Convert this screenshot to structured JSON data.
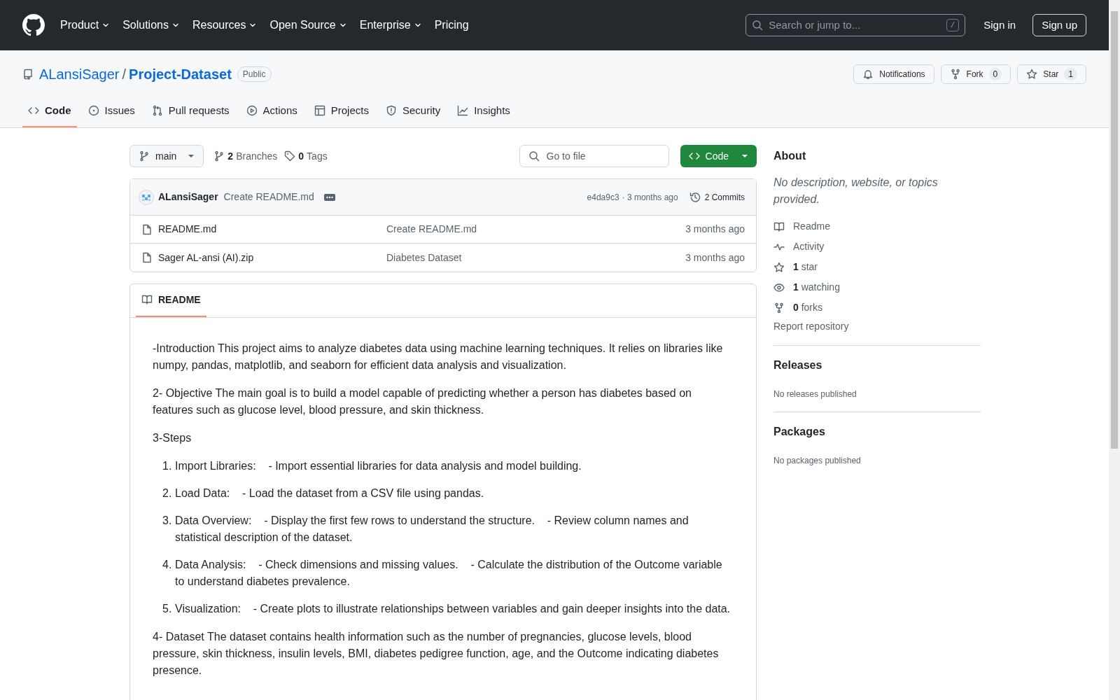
{
  "header": {
    "nav": [
      {
        "label": "Product",
        "dropdown": true
      },
      {
        "label": "Solutions",
        "dropdown": true
      },
      {
        "label": "Resources",
        "dropdown": true
      },
      {
        "label": "Open Source",
        "dropdown": true
      },
      {
        "label": "Enterprise",
        "dropdown": true
      },
      {
        "label": "Pricing",
        "dropdown": false
      }
    ],
    "search": {
      "placeholder": "Search or jump to...",
      "shortcut": "/"
    },
    "sign_in": "Sign in",
    "sign_up": "Sign up"
  },
  "repo": {
    "owner": "ALansiSager",
    "separator": "/",
    "name": "Project-Dataset",
    "visibility": "Public",
    "actions": [
      {
        "kind": "notifications",
        "label": "Notifications"
      },
      {
        "kind": "fork",
        "label": "Fork",
        "count": "0"
      },
      {
        "kind": "star",
        "label": "Star",
        "count": "1"
      }
    ]
  },
  "tabs": [
    {
      "kind": "code",
      "label": "Code",
      "selected": true
    },
    {
      "kind": "issues",
      "label": "Issues",
      "selected": false
    },
    {
      "kind": "pulls",
      "label": "Pull requests",
      "selected": false
    },
    {
      "kind": "actions",
      "label": "Actions",
      "selected": false
    },
    {
      "kind": "projects",
      "label": "Projects",
      "selected": false
    },
    {
      "kind": "security",
      "label": "Security",
      "selected": false
    },
    {
      "kind": "insights",
      "label": "Insights",
      "selected": false
    }
  ],
  "toolbar": {
    "branch": "main",
    "branches_count": "2",
    "branches_label": "Branches",
    "tags_count": "0",
    "tags_label": "Tags",
    "go_to_file": "Go to file",
    "code_button": "Code"
  },
  "latest_commit": {
    "author": "ALansiSager",
    "message": "Create README.md",
    "hash": "e4da9c3",
    "time": "· 3 months ago",
    "commits": "2 Commits"
  },
  "files": [
    {
      "name": "README.md",
      "message": "Create README.md",
      "time": "3 months ago"
    },
    {
      "name": "Sager AL-ansi (AI).zip",
      "message": "Diabetes Dataset",
      "time": "3 months ago"
    }
  ],
  "readme": {
    "tab": "README",
    "blocks": [
      {
        "kind": "paragraph",
        "text": "-Introduction This project aims to analyze diabetes data using machine learning techniques. It relies on libraries like numpy, pandas, matplotlib, and seaborn for efficient data analysis and visualization."
      },
      {
        "kind": "paragraph",
        "text": "2- Objective The main goal is to build a model capable of predicting whether a person has diabetes based on features such as glucose level, blood pressure, and skin thickness."
      },
      {
        "kind": "paragraph",
        "text": "3-Steps"
      },
      {
        "kind": "list",
        "items": [
          {
            "number": "1.",
            "text": "Import Libraries:    - Import essential libraries for data analysis and model building."
          },
          {
            "number": "2.",
            "text": "Load Data:    - Load the dataset from a CSV file using pandas."
          },
          {
            "number": "3.",
            "text": "Data Overview:    - Display the first few rows to understand the structure.    - Review column names and statistical description of the dataset."
          },
          {
            "number": "4.",
            "text": "Data Analysis:    - Check dimensions and missing values.    - Calculate the distribution of the Outcome variable to understand diabetes prevalence."
          },
          {
            "number": "5.",
            "text": "Visualization:    - Create plots to illustrate relationships between variables and gain deeper insights into the data."
          }
        ]
      },
      {
        "kind": "paragraph",
        "text": "4- Dataset The dataset contains health information such as the number of pregnancies, glucose levels, blood pressure, skin thickness, insulin levels, BMI, diabetes pedigree function, age, and the Outcome indicating diabetes presence."
      }
    ]
  },
  "about": {
    "title": "About",
    "description": "No description, website, or topics provided.",
    "links": [
      {
        "kind": "readme",
        "label": "Readme"
      },
      {
        "kind": "activity",
        "label": "Activity"
      },
      {
        "kind": "star",
        "count": "1",
        "label": "star"
      },
      {
        "kind": "watch",
        "count": "1",
        "label": "watching"
      },
      {
        "kind": "fork",
        "count": "0",
        "label": "forks"
      }
    ],
    "report": "Report repository"
  },
  "releases": {
    "title": "Releases",
    "empty": "No releases published"
  },
  "packages": {
    "title": "Packages",
    "empty": "No packages published"
  }
}
